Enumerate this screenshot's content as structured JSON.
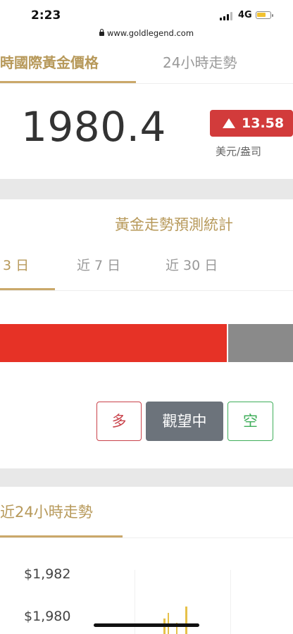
{
  "status_bar": {
    "time": "2:23",
    "network": "4G"
  },
  "browser": {
    "url": "www.goldlegend.com"
  },
  "price_section": {
    "tabs": [
      {
        "label": "時國際黃金價格",
        "active": true
      },
      {
        "label": "24小時走勢",
        "active": false
      }
    ],
    "price": "1980.4",
    "change": "13.58",
    "change_direction": "up",
    "unit": "美元/盎司"
  },
  "forecast_section": {
    "title": "黃金走勢預測統計",
    "tabs": [
      {
        "label": "3 日",
        "active": true
      },
      {
        "label": "近 7 日",
        "active": false
      },
      {
        "label": "近 30 日",
        "active": false
      }
    ],
    "bullish_fraction": 0.773,
    "buttons": {
      "long": "多",
      "neutral": "觀望中",
      "short": "空"
    }
  },
  "trend_section": {
    "title": "近24小時走勢",
    "y_ticks": [
      "$1,982",
      "$1,980"
    ]
  },
  "colors": {
    "gold_accent": "#b7995a",
    "up_red": "#d23b3b",
    "bar_red": "#e63226",
    "bar_gray": "#8a8a8a",
    "neutral_button": "#6c737b",
    "short_green": "#3fae5a"
  }
}
